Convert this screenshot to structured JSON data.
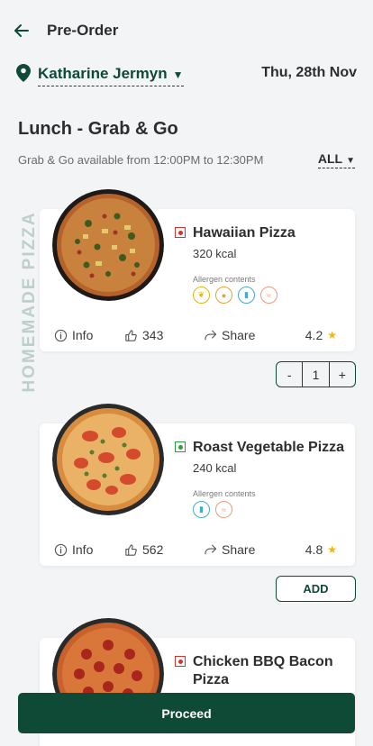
{
  "header": {
    "back_icon": "arrow-left-icon",
    "title": "Pre-Order"
  },
  "location": {
    "name": "Katharine Jermyn",
    "icon": "map-pin-icon"
  },
  "date": "Thu, 28th Nov",
  "section": {
    "title": "Lunch - Grab & Go",
    "availability": "Grab & Go available from 12:00PM to 12:30PM",
    "filter": "ALL"
  },
  "category_label": "HOMEMADE PIZZA",
  "colors": {
    "brand": "#0e4a36",
    "veg": "#2e9b3e",
    "nonveg": "#d0342c",
    "star": "#f2b705"
  },
  "items": [
    {
      "name": "Hawaiian Pizza",
      "kcal": "320 kcal",
      "diet": "non-veg",
      "allergen_label": "Allergen contents",
      "allergens": [
        "gluten-icon",
        "egg-icon",
        "milk-icon",
        "fish-icon"
      ],
      "info": "Info",
      "likes": "343",
      "share": "Share",
      "rating": "4.2",
      "quantity": "1"
    },
    {
      "name": "Roast Vegetable Pizza",
      "kcal": "240 kcal",
      "diet": "veg",
      "allergen_label": "Allergen contents",
      "allergens": [
        "milk-icon",
        "fish-icon"
      ],
      "info": "Info",
      "likes": "562",
      "share": "Share",
      "rating": "4.8",
      "add": "ADD"
    },
    {
      "name": "Chicken BBQ Bacon Pizza",
      "diet": "non-veg"
    }
  ],
  "stepper": {
    "minus": "-",
    "plus": "+"
  },
  "proceed": "Proceed"
}
